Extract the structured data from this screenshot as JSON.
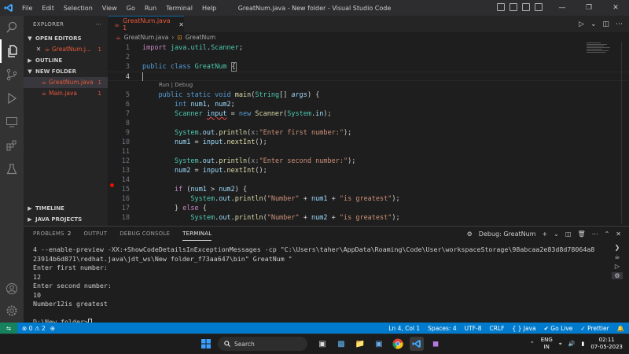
{
  "window": {
    "title": "GreatNum.java - New folder - Visual Studio Code",
    "menu": [
      "File",
      "Edit",
      "Selection",
      "View",
      "Go",
      "Run",
      "Terminal",
      "Help"
    ]
  },
  "sidebar": {
    "header": "EXPLORER",
    "open_editors": "OPEN EDITORS",
    "open_file": {
      "name": "GreatNum.j...",
      "badge": "1"
    },
    "outline": "OUTLINE",
    "folder": "NEW FOLDER",
    "files": [
      {
        "name": "GreatNum.java",
        "badge": "1"
      },
      {
        "name": "Main.java",
        "badge": "1"
      }
    ],
    "timeline": "TIMELINE",
    "java_projects": "JAVA PROJECTS"
  },
  "editor": {
    "tab_label": "GreatNum.java 1",
    "breadcrumb": {
      "file": "GreatNum.java",
      "class": "GreatNum"
    },
    "codelens": "Run | Debug",
    "line_numbers": [
      "1",
      "2",
      "3",
      "4",
      "5",
      "6",
      "7",
      "8",
      "9",
      "10",
      "11",
      "12",
      "13",
      "14",
      "15",
      "16",
      "17",
      "18"
    ],
    "current_line": "4"
  },
  "panel": {
    "tabs": [
      {
        "label": "PROBLEMS",
        "count": "2"
      },
      {
        "label": "OUTPUT"
      },
      {
        "label": "DEBUG CONSOLE"
      },
      {
        "label": "TERMINAL"
      }
    ],
    "active_terminal": "Debug: GreatNum",
    "terminal_lines": [
      "4 --enable-preview -XX:+ShowCodeDetailsInExceptionMessages -cp \"C:\\Users\\taher\\AppData\\Roaming\\Code\\User\\workspaceStorage\\98abcaa2e83d8d78064a8",
      "23914b6d871\\redhat.java\\jdt_ws\\New folder_f73aa647\\bin\" GreatNum \"",
      "Enter first number:",
      "12",
      "Enter second number:",
      "10",
      "Number12is greatest",
      "",
      "D:\\New folder>"
    ]
  },
  "statusbar": {
    "errors": "0",
    "warnings": "2",
    "position": "Ln 4, Col 1",
    "spaces": "Spaces: 4",
    "encoding": "UTF-8",
    "eol": "CRLF",
    "language": "{ } Java",
    "golive": "Go Live",
    "prettier": "Prettier"
  },
  "taskbar": {
    "search_placeholder": "Search",
    "lang_top": "ENG",
    "lang_bottom": "IN",
    "time": "02:11",
    "date": "07-05-2023"
  },
  "colors": {
    "accent": "#007acc",
    "error_file": "#e8583a"
  }
}
